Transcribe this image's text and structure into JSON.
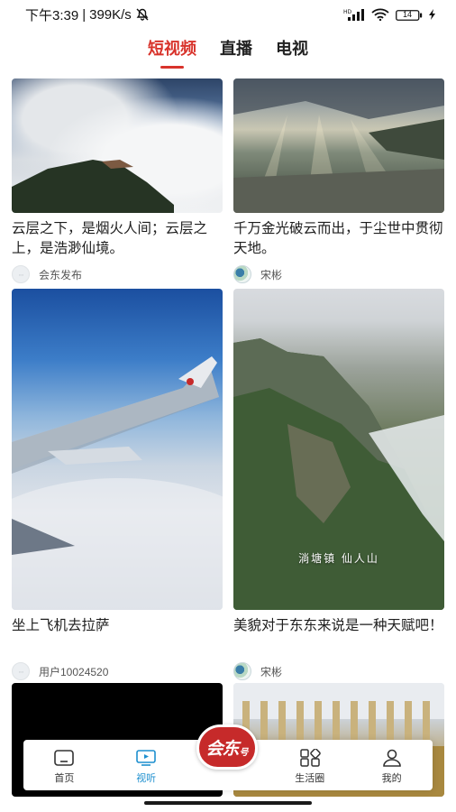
{
  "status_bar": {
    "time": "下午3:39",
    "separator": "|",
    "speed": "399K/s",
    "battery": "14",
    "network_type": "HD"
  },
  "tabs": [
    {
      "label": "短视频",
      "active": true
    },
    {
      "label": "直播",
      "active": false
    },
    {
      "label": "电视",
      "active": false
    }
  ],
  "feed": {
    "cards": [
      {
        "title": "云层之下，是烟火人间；云层之上，是浩渺仙境。",
        "author": "会东发布",
        "avatar": "dots",
        "scene": "sky-cloud"
      },
      {
        "title": "千万金光破云而出，于尘世中贯彻天地。",
        "author": "宋彬",
        "avatar": "photo",
        "scene": "sun-rays"
      },
      {
        "title": "坐上飞机去拉萨",
        "author": "用户10024520",
        "avatar": "dots",
        "scene": "plane-sky"
      },
      {
        "title": "美貌对于东东来说是一种天赋吧！",
        "author": "宋彬",
        "avatar": "photo",
        "scene": "mountain",
        "overlay": "淌塘镇 仙人山"
      },
      {
        "title": "",
        "author": "",
        "scene": "black-video"
      },
      {
        "title": "",
        "author": "",
        "scene": "factory"
      }
    ]
  },
  "bottom_nav": {
    "items": [
      {
        "label": "首页",
        "icon": "home-icon",
        "active": false
      },
      {
        "label": "视听",
        "icon": "tv-icon",
        "active": true
      },
      {
        "label": "生活圈",
        "icon": "grid-icon",
        "active": false
      },
      {
        "label": "我的",
        "icon": "person-icon",
        "active": false
      }
    ],
    "logo_big": "会东",
    "logo_small": "号"
  },
  "colors": {
    "accent": "#d8332b",
    "nav_active": "#1d8fcf",
    "logo_red": "#c62a2a"
  }
}
